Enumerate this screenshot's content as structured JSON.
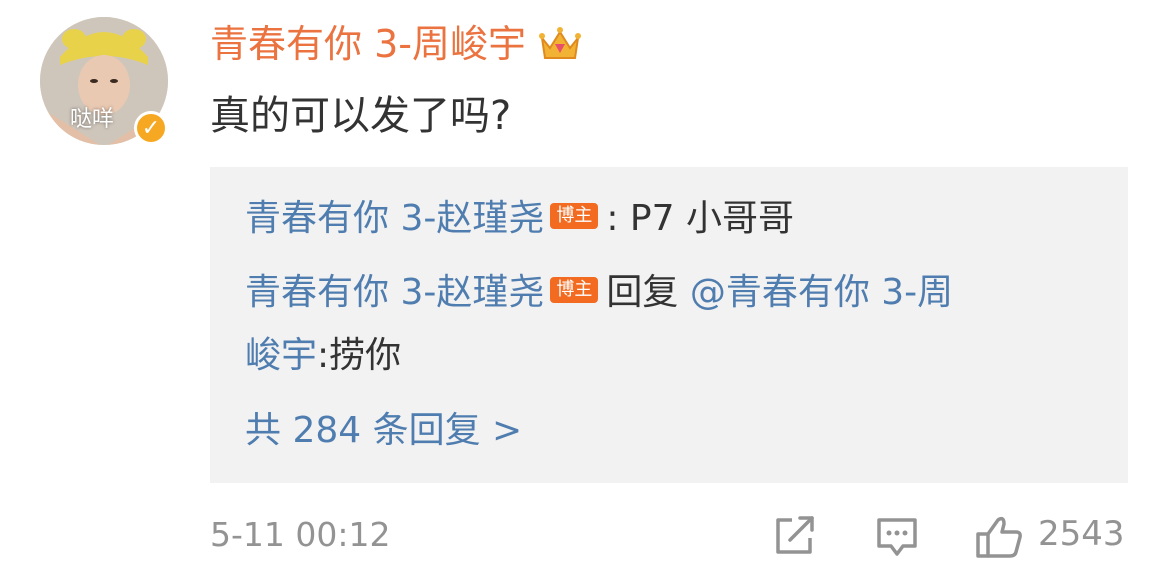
{
  "comment": {
    "username": "青春有你 3-周峻宇",
    "avatar_tag": "哒咩",
    "text": "真的可以发了吗?",
    "timestamp": "5-11 00:12",
    "like_count": "2543"
  },
  "replies": [
    {
      "author": "青春有你 3-赵瑾尧",
      "badge": "博主",
      "content": ": P7 小哥哥"
    },
    {
      "author": "青春有你 3-赵瑾尧",
      "badge": "博主",
      "content_prefix": "回复",
      "mention": "@青春有你 3-周",
      "mention_cont": "峻宇",
      "content": ":捞你"
    }
  ],
  "more_replies": "共 284 条回复 >",
  "colors": {
    "username": "#eb7340",
    "link": "#507daf",
    "badge": "#f26b21",
    "verified": "#f7a823",
    "reply_bg": "#f2f2f2",
    "meta": "#939393"
  },
  "icons": [
    "crown-icon",
    "verified-icon",
    "repost-icon",
    "comment-icon",
    "like-icon"
  ]
}
